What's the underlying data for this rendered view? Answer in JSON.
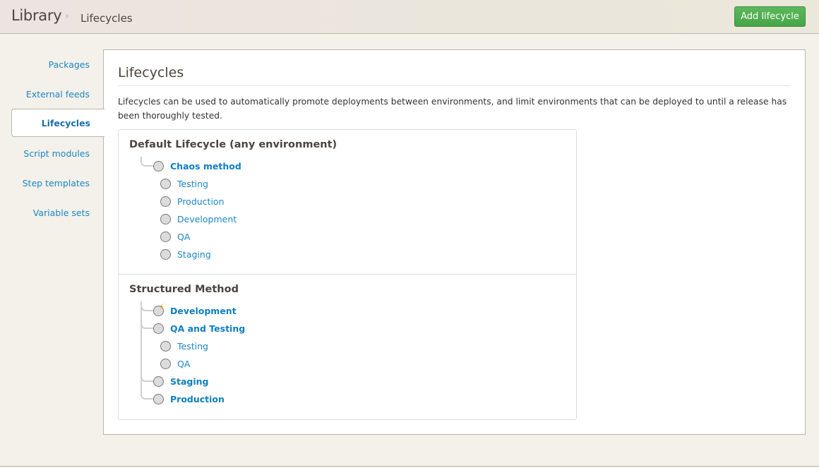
{
  "header": {
    "breadcrumb_root": "Library",
    "breadcrumb_separator": "›",
    "breadcrumb_current": "Lifecycles",
    "add_button_label": "Add lifecycle"
  },
  "sidebar": {
    "items": [
      {
        "label": "Packages"
      },
      {
        "label": "External feeds"
      },
      {
        "label": "Lifecycles",
        "active": true
      },
      {
        "label": "Script modules"
      },
      {
        "label": "Step templates"
      },
      {
        "label": "Variable sets"
      }
    ]
  },
  "main": {
    "title": "Lifecycles",
    "description": "Lifecycles can be used to automatically promote deployments between environments, and limit environments that can be deployed to until a release has been thoroughly tested.",
    "lifecycles": [
      {
        "name": "Default Lifecycle (any environment)",
        "phases": [
          {
            "name": "Chaos method",
            "icon": "circle-icon",
            "environments": [
              "Testing",
              "Production",
              "Development",
              "QA",
              "Staging"
            ]
          }
        ]
      },
      {
        "name": "Structured Method",
        "phases": [
          {
            "name": "Development",
            "icon": "automatic-deploy-bolt-icon",
            "environments": []
          },
          {
            "name": "QA and Testing",
            "icon": "circle-icon",
            "environments": [
              "Testing",
              "QA"
            ]
          },
          {
            "name": "Staging",
            "icon": "circle-icon",
            "environments": []
          },
          {
            "name": "Production",
            "icon": "circle-icon",
            "environments": []
          }
        ]
      }
    ]
  },
  "colors": {
    "link": "#1a87c5",
    "accent_green": "#5cb85c",
    "bolt": "#f0a01c",
    "background": "#f4f1ea"
  }
}
